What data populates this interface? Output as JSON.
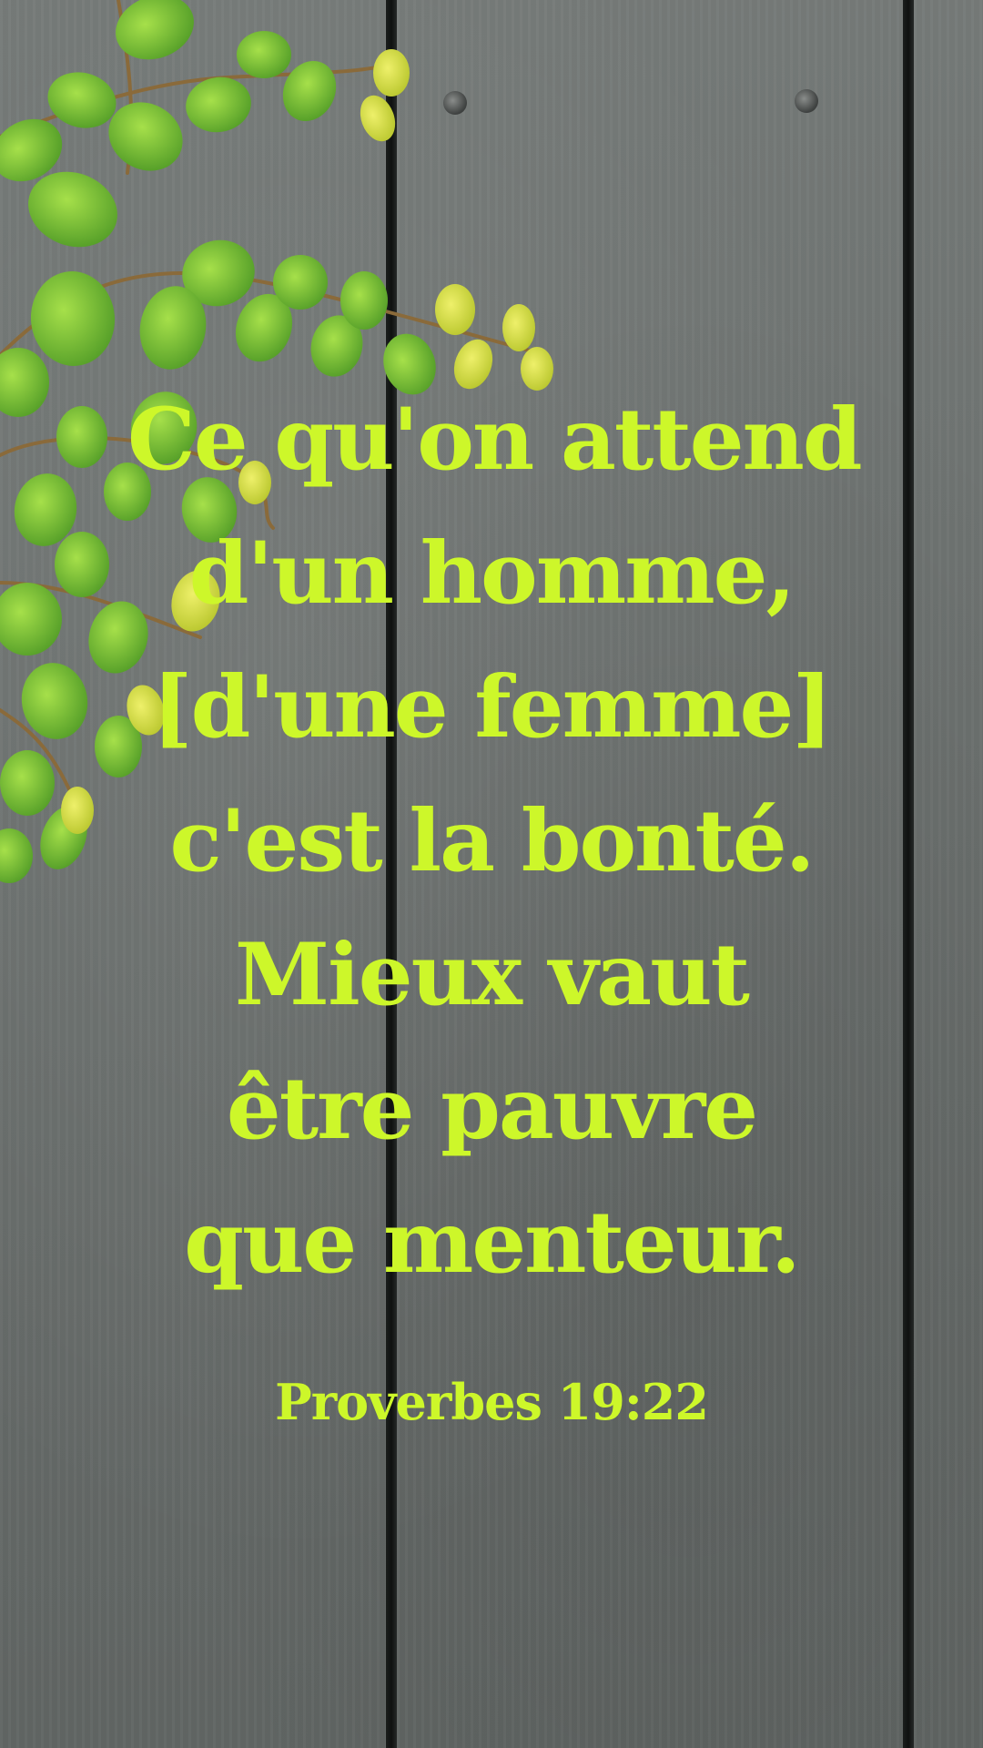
{
  "verse": {
    "lines": [
      "Ce qu'on attend",
      "d'un homme,",
      "[d'une femme]",
      "c'est la bonté.",
      "Mieux vaut",
      "être pauvre",
      "que menteur."
    ],
    "reference": "Proverbes 19:22",
    "text_color": "#cdf72a"
  },
  "background": {
    "description_icon": "wooden-plank-wall-with-vine",
    "plank_color": "#6f7371",
    "leaf_color": "#7cc63a",
    "leaf_highlight_color": "#c8e23a"
  }
}
